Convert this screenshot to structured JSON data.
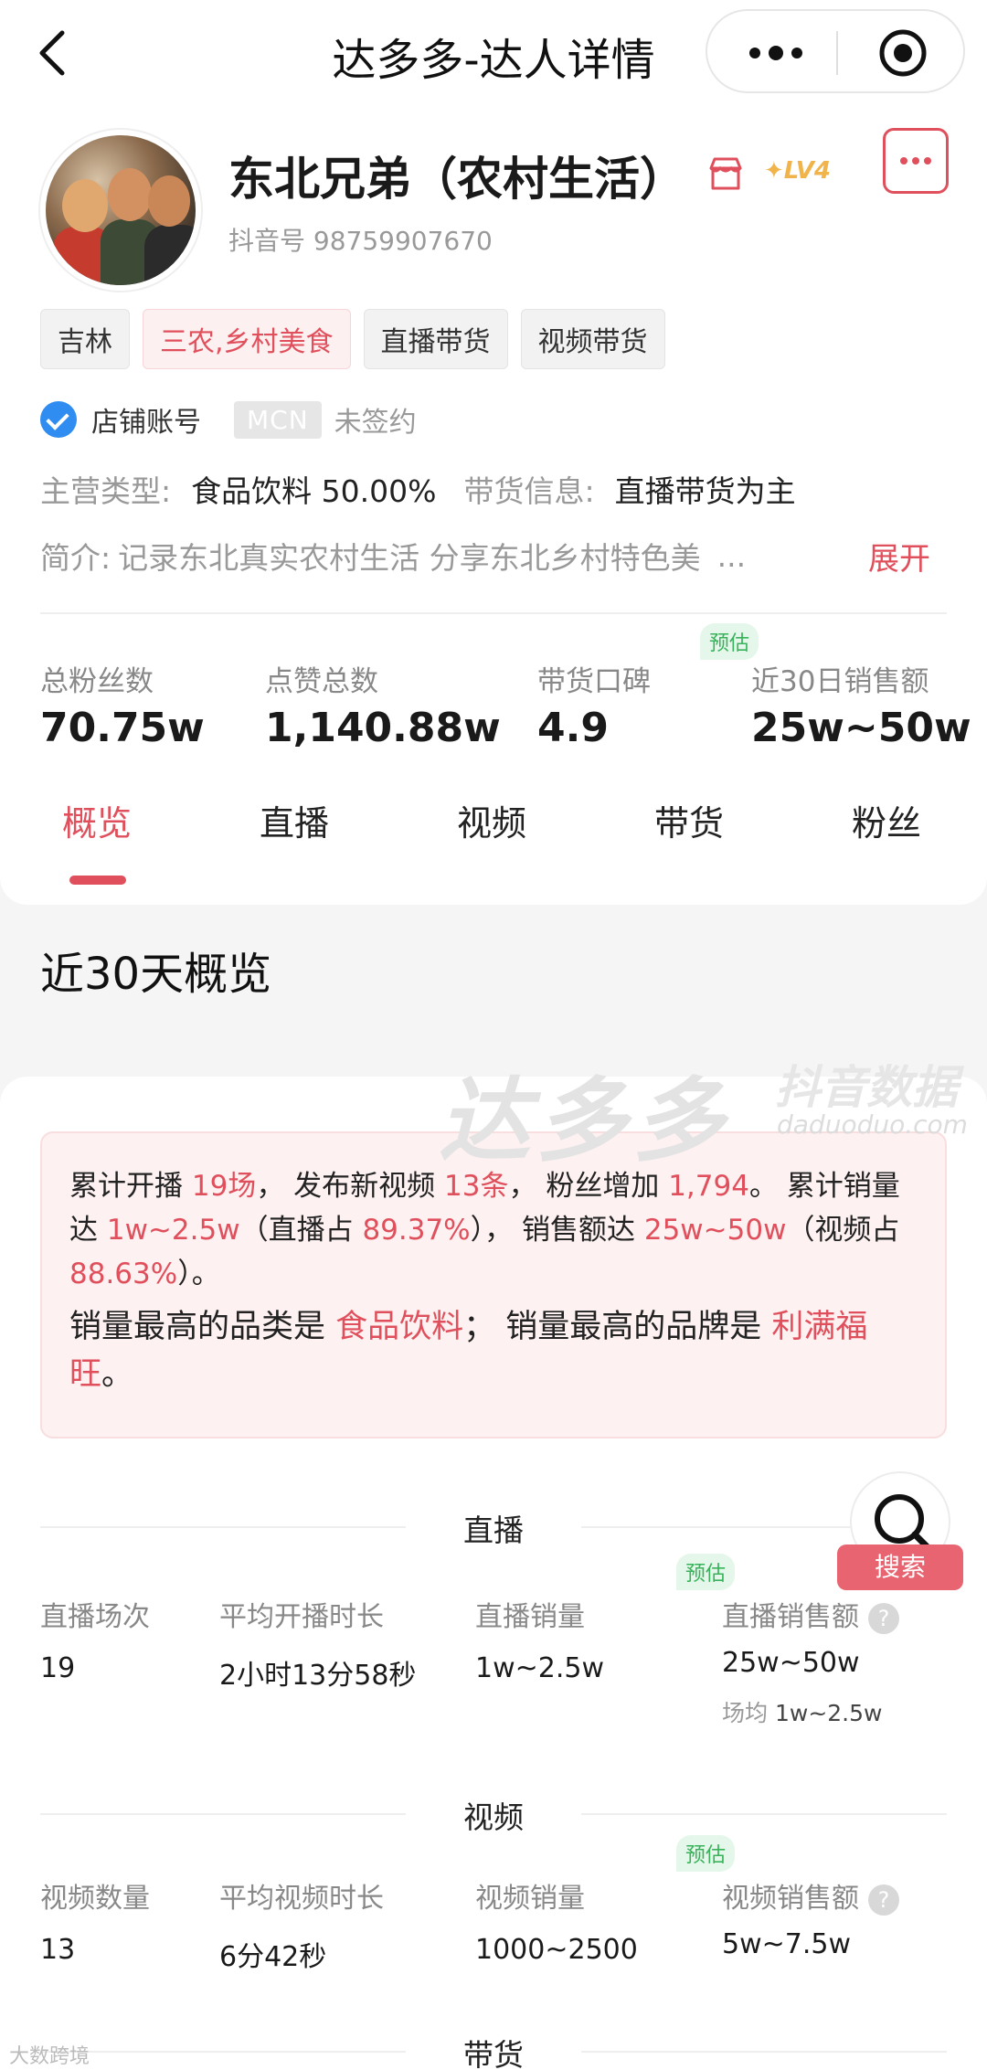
{
  "nav": {
    "title": "达多多-达人详情"
  },
  "profile": {
    "name": "东北兄弟（农村生活）",
    "level": "LV4",
    "douyin_id": "抖音号 98759907670",
    "tags": [
      "吉林",
      "三农,乡村美食",
      "直播带货",
      "视频带货"
    ],
    "account_type": "店铺账号",
    "mcn_label": "MCN",
    "mcn_status": "未签约",
    "main_category_label": "主营类型:",
    "main_category_value": "食品饮料 50.00%",
    "sales_info_label": "带货信息:",
    "sales_info_value": "直播带货为主",
    "intro_label": "简介:",
    "intro_text": "记录东北真实农村生活 分享东北乡村特色美",
    "intro_ellipsis": "...",
    "expand_label": "展开"
  },
  "stats": [
    {
      "label": "总粉丝数",
      "value": "70.75w"
    },
    {
      "label": "点赞总数",
      "value": "1,140.88w"
    },
    {
      "label": "带货口碑",
      "value": "4.9"
    },
    {
      "label": "近30日销售额",
      "value": "25w~50w",
      "badge": "预估"
    }
  ],
  "tabs": [
    "概览",
    "直播",
    "视频",
    "带货",
    "粉丝"
  ],
  "section_title": "近30天概览",
  "watermark": {
    "main": "达多多",
    "sub": "抖音数据",
    "url": "daduoduo.com"
  },
  "summary": {
    "s1": "累计开播 ",
    "v1": "19场",
    "s2": "， 发布新视频 ",
    "v2": "13条",
    "s3": "， 粉丝增加 ",
    "v3": "1,794",
    "s4": "。 累计销量达 ",
    "v4": "1w~2.5w",
    "s5": "（直播占 ",
    "v5": "89.37%",
    "s6": "）， 销售额达 ",
    "v6": "25w~50w",
    "s7": "（视频占 ",
    "v7": "88.63%",
    "s8": "）。",
    "b1": "销量最高的品类是 ",
    "bv1": "食品饮料",
    "b2": "； 销量最高的品牌是 ",
    "bv2": "利满福旺",
    "b3": "。"
  },
  "live": {
    "header": "直播",
    "badge": "预估",
    "metrics": [
      {
        "label": "直播场次",
        "value": "19"
      },
      {
        "label": "平均开播时长",
        "value": "2小时13分58秒"
      },
      {
        "label": "直播销量",
        "value": "1w~2.5w"
      },
      {
        "label": "直播销售额",
        "value": "25w~50w"
      }
    ],
    "avg_label": "场均",
    "avg_value": "1w~2.5w"
  },
  "video": {
    "header": "视频",
    "badge": "预估",
    "metrics": [
      {
        "label": "视频数量",
        "value": "13"
      },
      {
        "label": "平均视频时长",
        "value": "6分42秒"
      },
      {
        "label": "视频销量",
        "value": "1000~2500"
      },
      {
        "label": "视频销售额",
        "value": "5w~7.5w"
      }
    ]
  },
  "goods": {
    "header": "带货"
  },
  "search": {
    "label": "搜索"
  },
  "footer": {
    "watermark": "大数跨境"
  }
}
